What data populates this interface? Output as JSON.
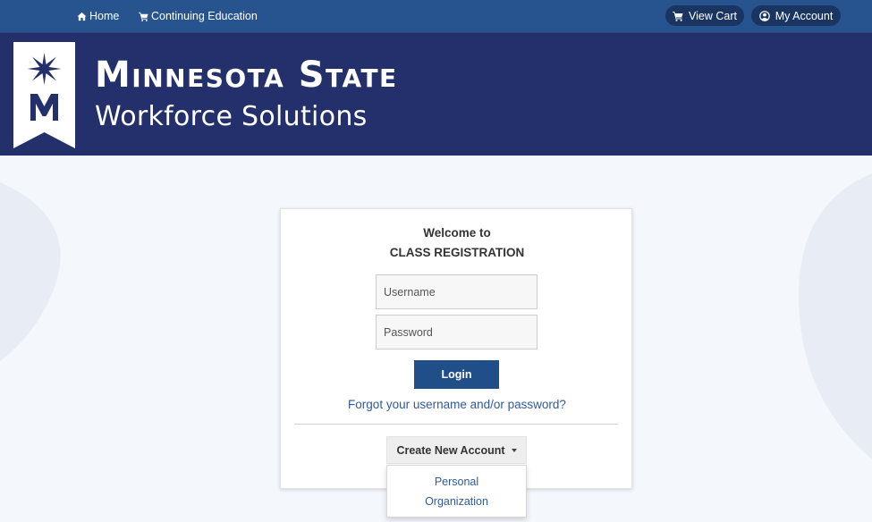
{
  "topnav": {
    "home": "Home",
    "continuing_education": "Continuing Education",
    "view_cart": "View Cart",
    "my_account": "My Account"
  },
  "banner": {
    "line1": "Minnesota State",
    "line2": "Workforce Solutions"
  },
  "login": {
    "welcome_line1": "Welcome to",
    "welcome_line2": "CLASS REGISTRATION",
    "username_placeholder": "Username",
    "password_placeholder": "Password",
    "login_label": "Login",
    "forgot_link": "Forgot your username and/or password?",
    "create_account_label": "Create New Account",
    "account_options": [
      "Personal",
      "Organization"
    ]
  },
  "colors": {
    "nav_bg": "#27548f",
    "banner_bg": "#24306b",
    "button_primary": "#1f4e89",
    "link": "#2f5a9e"
  }
}
